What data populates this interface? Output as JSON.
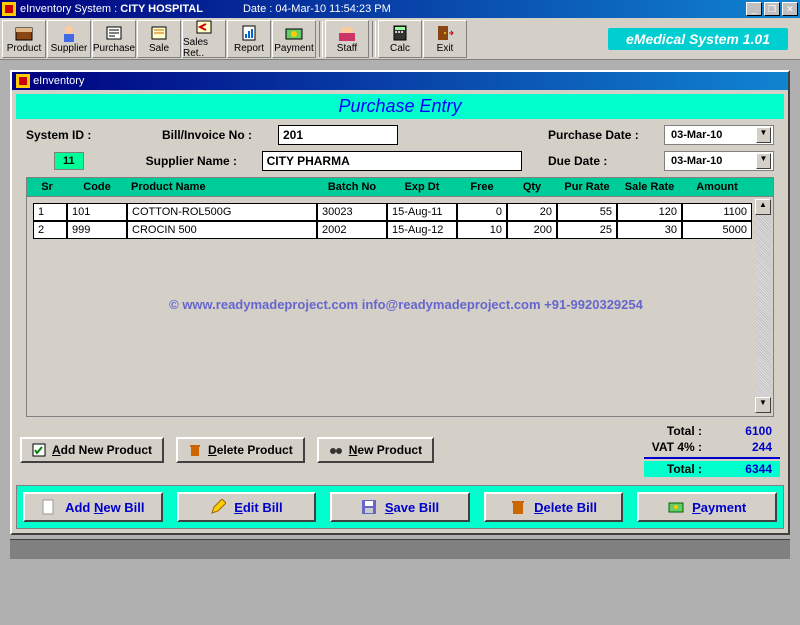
{
  "titlebar": {
    "appname": "eInventory System",
    "context": "CITY HOSPITAL",
    "datetime_label": "Date : 04-Mar-10 11:54:23 PM"
  },
  "toolbar": {
    "items": [
      {
        "label": "Product"
      },
      {
        "label": "Supplier"
      },
      {
        "label": "Purchase"
      },
      {
        "label": "Sale"
      },
      {
        "label": "Sales Ret.."
      },
      {
        "label": "Report"
      },
      {
        "label": "Payment"
      },
      {
        "label": "Staff"
      },
      {
        "label": "Calc"
      },
      {
        "label": "Exit"
      }
    ]
  },
  "brand": "eMedical System 1.01",
  "child": {
    "title": "eInventory",
    "heading": "Purchase Entry",
    "form": {
      "systemid_label": "System ID :",
      "systemid_value": "11",
      "billno_label": "Bill/Invoice No :",
      "billno_value": "201",
      "purchdate_label": "Purchase Date :",
      "purchdate_value": "03-Mar-10",
      "supplier_label": "Supplier Name :",
      "supplier_value": "CITY PHARMA",
      "duedate_label": "Due Date :",
      "duedate_value": "03-Mar-10"
    },
    "grid": {
      "headers": {
        "sr": "Sr",
        "code": "Code",
        "name": "Product Name",
        "batch": "Batch No",
        "exp": "Exp Dt",
        "free": "Free",
        "qty": "Qty",
        "pur": "Pur Rate",
        "sale": "Sale Rate",
        "amt": "Amount"
      },
      "rows": [
        {
          "sr": "1",
          "code": "101",
          "name": "COTTON-ROL500G",
          "batch": "30023",
          "exp": "15-Aug-11",
          "free": "0",
          "qty": "20",
          "pur": "55",
          "sale": "120",
          "amt": "1100"
        },
        {
          "sr": "2",
          "code": "999",
          "name": "CROCIN 500",
          "batch": "2002",
          "exp": "15-Aug-12",
          "free": "10",
          "qty": "200",
          "pur": "25",
          "sale": "30",
          "amt": "5000"
        }
      ]
    },
    "watermark": "©  www.readymadeproject.com  info@readymadeproject.com  +91-9920329254",
    "actions": {
      "add_product": "Add New Product",
      "delete_product": "Delete Product",
      "new_product": "New Product"
    },
    "totals": {
      "total_label": "Total :",
      "total_value": "6100",
      "vat_label": "VAT 4% :",
      "vat_value": "244",
      "grand_label": "Total :",
      "grand_value": "6344"
    },
    "bottom": {
      "add_bill": "Add New Bill",
      "edit_bill": "Edit Bill",
      "save_bill": "Save Bill",
      "delete_bill": "Delete Bill",
      "payment": "Payment"
    }
  }
}
